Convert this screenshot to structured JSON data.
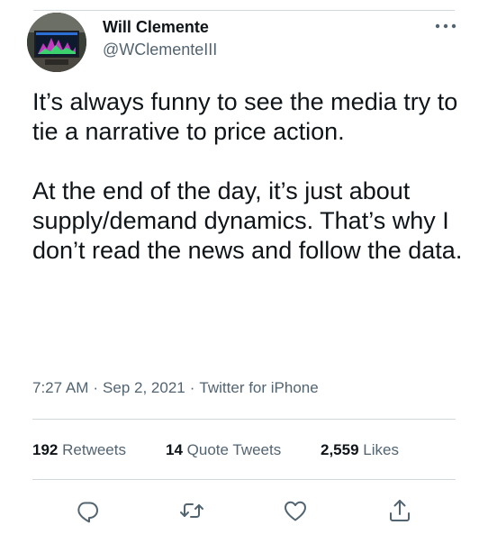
{
  "author": {
    "name": "Will Clemente",
    "handle": "@WClementeIII"
  },
  "tweet": {
    "paragraphs": [
      "It’s always funny to see the media try to tie a narrative to price action.",
      "At the end of the day, it’s just about supply/demand dynamics. That’s why I don’t read the news and follow the data."
    ],
    "time": "7:27 AM",
    "date": "Sep 2, 2021",
    "source": "Twitter for iPhone",
    "separator": "·"
  },
  "stats": {
    "retweets": {
      "count": "192",
      "label": "Retweets"
    },
    "quotes": {
      "count": "14",
      "label": "Quote Tweets"
    },
    "likes": {
      "count": "2,559",
      "label": "Likes"
    }
  },
  "icons": {
    "more": "more-icon",
    "reply": "reply-icon",
    "retweet": "retweet-icon",
    "like": "like-icon",
    "share": "share-icon"
  },
  "colors": {
    "text": "#0f1419",
    "secondary": "#536471",
    "divider": "#cfd9de",
    "action_icon": "#536471"
  }
}
